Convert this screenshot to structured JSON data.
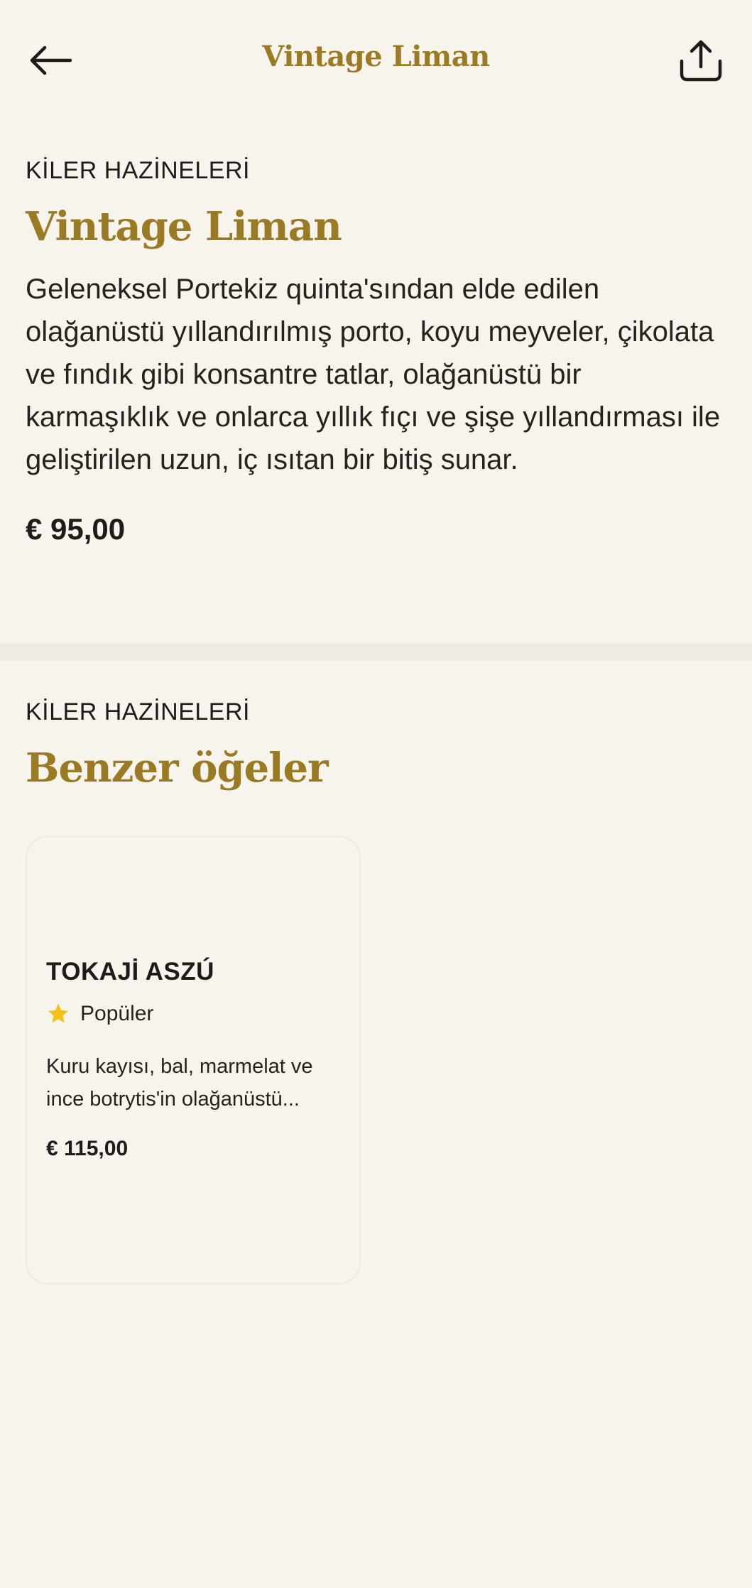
{
  "header": {
    "title": "Vintage Liman",
    "back_icon": "arrow-left-icon",
    "share_icon": "share-upload-icon"
  },
  "product": {
    "category": "KİLER HAZİNELERİ",
    "name": "Vintage Liman",
    "description": "Geleneksel Portekiz quinta'sından elde edilen olağanüstü yıllandırılmış porto, koyu meyveler, çikolata ve fındık gibi konsantre tatlar, olağanüstü bir karmaşıklık ve onlarca yıllık fıçı ve şişe yıllandırması ile geliştirilen uzun, iç ısıtan bir bitiş sunar.",
    "price": "€ 95,00"
  },
  "similar": {
    "category": "KİLER HAZİNELERİ",
    "heading": "Benzer öğeler",
    "items": [
      {
        "name": "TOKAJİ ASZÚ",
        "badge": "Popüler",
        "badge_icon": "star-icon",
        "description": "Kuru kayısı, bal, marmelat ve ince botrytis'in olağanüstü...",
        "price": "€ 115,00"
      }
    ]
  },
  "colors": {
    "background": "#f7f4ee",
    "accent_gold": "#9a7b24",
    "text": "#1f1b16",
    "star": "#f2c21b"
  }
}
